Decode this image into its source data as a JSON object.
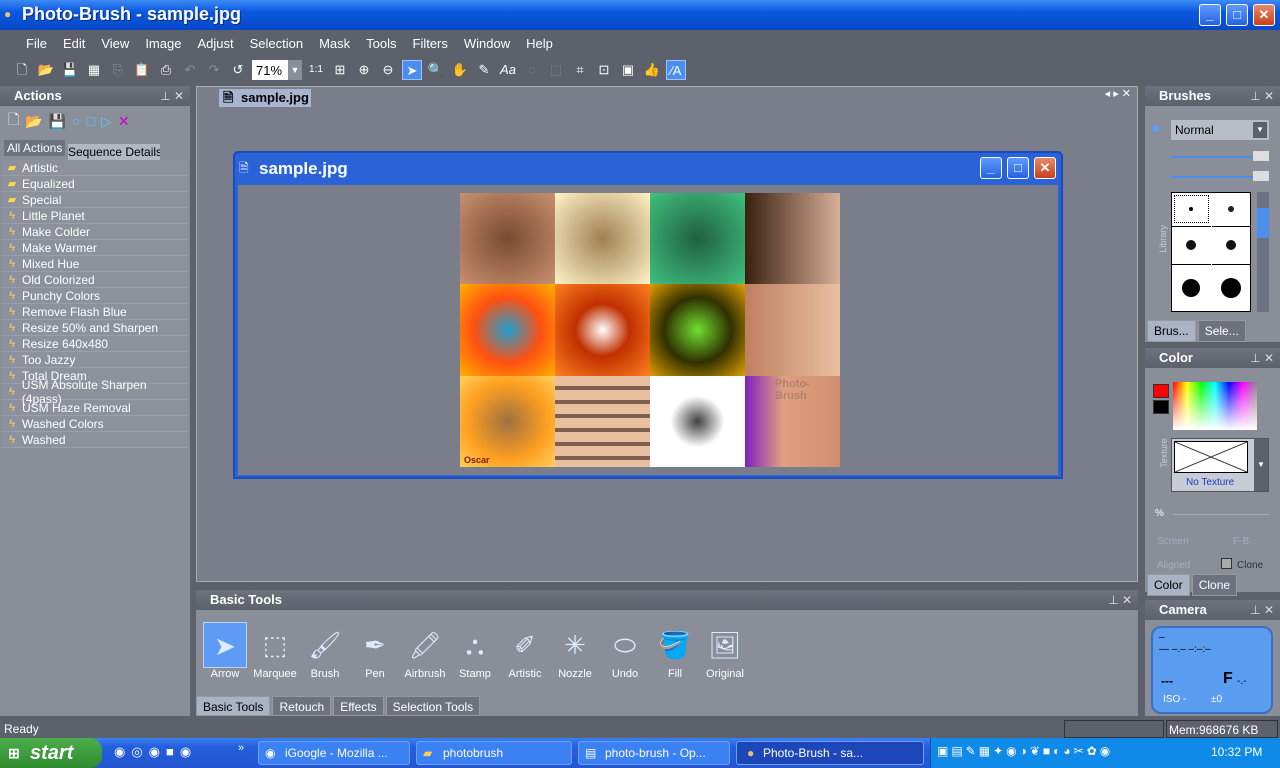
{
  "window": {
    "title": "Photo-Brush - sample.jpg",
    "min": "_",
    "max": "□",
    "close": "✕"
  },
  "menu": [
    "File",
    "Edit",
    "View",
    "Image",
    "Adjust",
    "Selection",
    "Mask",
    "Tools",
    "Filters",
    "Window",
    "Help"
  ],
  "toolbar": {
    "zoom": "71%",
    "actual_size": "1:1"
  },
  "actions": {
    "title": "Actions",
    "tab_all": "All Actions",
    "tab_seq": "Sequence Details",
    "items": [
      {
        "label": "Artistic",
        "type": "folder"
      },
      {
        "label": "Equalized",
        "type": "folder"
      },
      {
        "label": "Special",
        "type": "folder"
      },
      {
        "label": "Little Planet",
        "type": "action"
      },
      {
        "label": "Make Colder",
        "type": "action"
      },
      {
        "label": "Make Warmer",
        "type": "action"
      },
      {
        "label": "Mixed Hue",
        "type": "action"
      },
      {
        "label": "Old Colorized",
        "type": "action"
      },
      {
        "label": "Punchy Colors",
        "type": "action"
      },
      {
        "label": "Remove Flash Blue",
        "type": "action"
      },
      {
        "label": "Resize 50% and Sharpen",
        "type": "action"
      },
      {
        "label": "Resize 640x480",
        "type": "action"
      },
      {
        "label": "Too Jazzy",
        "type": "action"
      },
      {
        "label": "Total Dream",
        "type": "action"
      },
      {
        "label": "USM Absolute Sharpen (4pass)",
        "type": "action"
      },
      {
        "label": "USM Haze Removal",
        "type": "action"
      },
      {
        "label": "Washed Colors",
        "type": "action"
      },
      {
        "label": "Washed",
        "type": "action"
      }
    ]
  },
  "document": {
    "tab": "sample.jpg",
    "window_title": "sample.jpg",
    "watermark": "Photo-Brush",
    "signature": "Oscar"
  },
  "basic_tools": {
    "title": "Basic Tools",
    "tools": [
      "Arrow",
      "Marquee",
      "Brush",
      "Pen",
      "Airbrush",
      "Stamp",
      "Artistic",
      "Nozzle",
      "Undo",
      "Fill",
      "Original"
    ],
    "active": "Arrow",
    "tabs": [
      "Basic Tools",
      "Retouch",
      "Effects",
      "Selection Tools"
    ]
  },
  "brushes": {
    "title": "Brushes",
    "mode": "Normal",
    "library_label": "Library",
    "tabs": [
      "Brus...",
      "Sele..."
    ]
  },
  "color": {
    "title": "Color",
    "foreground": "#ff0000",
    "background": "#000000",
    "texture_label": "Texture",
    "texture": "No Texture",
    "percent": "%",
    "opt_screen": "Screen",
    "opt_fb": "F-B",
    "opt_aligned": "Aligned",
    "clone_label": "Clone",
    "tabs": [
      "Color",
      "Clone"
    ]
  },
  "camera": {
    "title": "Camera",
    "line1": "–",
    "line2": "—  –.–  –:–:–",
    "shutter": "---",
    "aperture": "F",
    "aperture_val": "-.-",
    "iso": "ISO -",
    "ev": "±0"
  },
  "status": {
    "text": "Ready",
    "mem": "Mem:968676 KB"
  },
  "taskbar": {
    "start": "start",
    "tasks": [
      "iGoogle - Mozilla ...",
      "photobrush",
      "photo-brush - Op...",
      "Photo-Brush - sa..."
    ],
    "active": 3,
    "clock": "10:32 PM"
  }
}
